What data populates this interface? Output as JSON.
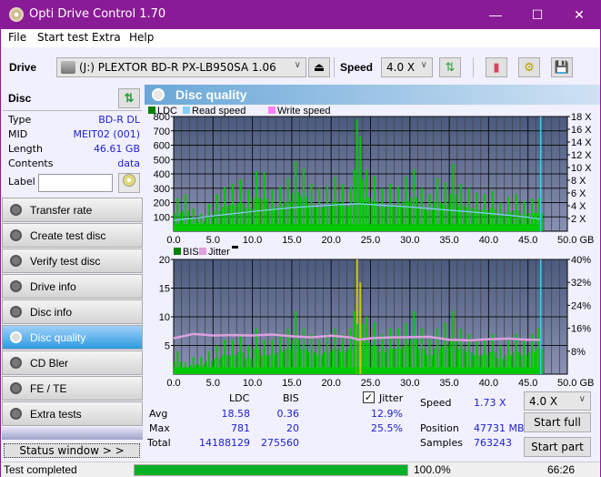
{
  "window": {
    "title": "Opti Drive Control 1.70",
    "minimize_icon": "minimize-icon",
    "maximize_icon": "maximize-icon",
    "close_icon": "close-icon"
  },
  "menu": [
    "File",
    "Start test",
    "Extra",
    "Help"
  ],
  "toolbar": {
    "drive_label": "Drive",
    "drive_value": "(J:)  PLEXTOR BD-R  PX-LB950SA 1.06",
    "speed_label": "Speed",
    "speed_value": "4.0 X"
  },
  "disc": {
    "header": "Disc",
    "fields": [
      {
        "key": "Type",
        "value": "BD-R DL"
      },
      {
        "key": "MID",
        "value": "MEIT02 (001)"
      },
      {
        "key": "Length",
        "value": "46.61 GB"
      },
      {
        "key": "Contents",
        "value": "data"
      }
    ],
    "label_key": "Label",
    "label_value": ""
  },
  "nav": [
    {
      "label": "Transfer rate",
      "active": false
    },
    {
      "label": "Create test disc",
      "active": false
    },
    {
      "label": "Verify test disc",
      "active": false
    },
    {
      "label": "Drive info",
      "active": false
    },
    {
      "label": "Disc info",
      "active": false
    },
    {
      "label": "Disc quality",
      "active": true
    },
    {
      "label": "CD Bler",
      "active": false
    },
    {
      "label": "FE / TE",
      "active": false
    },
    {
      "label": "Extra tests",
      "active": false
    }
  ],
  "status_window_label": "Status window > >",
  "main": {
    "title": "Disc quality"
  },
  "chart_data": [
    {
      "type": "bar",
      "title": "LDC",
      "legend": [
        "LDC",
        "Read speed",
        "Write speed"
      ],
      "legend_colors": {
        "LDC": "#008000",
        "Read speed": "#87cefa",
        "Write speed": "#ff80ff"
      },
      "xlabel": "GB",
      "x_ticks": [
        "0.0",
        "5.0",
        "10.0",
        "15.0",
        "20.0",
        "25.0",
        "30.0",
        "35.0",
        "40.0",
        "45.0",
        "50.0 GB"
      ],
      "xlim": [
        0,
        50
      ],
      "y_left_ticks": [
        "100",
        "200",
        "300",
        "400",
        "500",
        "600",
        "700",
        "800"
      ],
      "ylim_left": [
        0,
        800
      ],
      "y_right_ticks": [
        "2 X",
        "4 X",
        "6 X",
        "8 X",
        "10 X",
        "12 X",
        "14 X",
        "16 X",
        "18 X"
      ],
      "ylim_right": [
        0,
        18
      ],
      "series": [
        {
          "name": "LDC",
          "color": "#00c800",
          "x": [
            0.5,
            1.5,
            2.5,
            3.5,
            4.5,
            5.5,
            6.5,
            7.5,
            8.5,
            9.5,
            10.5,
            11.5,
            12.5,
            13.5,
            14.5,
            15.5,
            16.5,
            17.5,
            18.5,
            19.5,
            20.5,
            21.5,
            22.5,
            23.3,
            23.7,
            24.5,
            25.5,
            26.5,
            27.5,
            28.5,
            29.5,
            30.5,
            31.5,
            32.5,
            33.5,
            34.5,
            35.5,
            36.5,
            37.5,
            38.5,
            39.5,
            40.5,
            41.5,
            42.5,
            43.5,
            44.5,
            45.5,
            46.4
          ],
          "values": [
            230,
            260,
            160,
            120,
            190,
            260,
            310,
            330,
            360,
            290,
            420,
            410,
            290,
            310,
            370,
            490,
            440,
            330,
            300,
            320,
            380,
            330,
            310,
            781,
            660,
            430,
            380,
            300,
            330,
            310,
            380,
            430,
            300,
            260,
            370,
            340,
            470,
            330,
            300,
            270,
            260,
            280,
            200,
            240,
            260,
            210,
            230,
            230
          ]
        },
        {
          "name": "Read speed",
          "color": "#87cefa",
          "x": [
            0,
            5,
            10,
            15,
            20,
            23.5,
            25,
            30,
            35,
            40,
            45,
            46.6
          ],
          "values": [
            1.7,
            2.4,
            3.1,
            3.7,
            4.1,
            4.3,
            4.2,
            3.8,
            3.3,
            2.8,
            2.2,
            1.9
          ]
        }
      ],
      "end_marker_x": 46.61
    },
    {
      "type": "bar",
      "title": "BIS / Jitter",
      "legend": [
        "BIS",
        "Jitter"
      ],
      "legend_colors": {
        "BIS": "#008000",
        "Jitter": "#dda0dd"
      },
      "xlabel": "GB",
      "x_ticks": [
        "0.0",
        "5.0",
        "10.0",
        "15.0",
        "20.0",
        "25.0",
        "30.0",
        "35.0",
        "40.0",
        "45.0",
        "50.0 GB"
      ],
      "xlim": [
        0,
        50
      ],
      "y_left_ticks": [
        "5",
        "10",
        "15",
        "20"
      ],
      "ylim_left": [
        0,
        20
      ],
      "y_right_ticks": [
        "8%",
        "16%",
        "24%",
        "32%",
        "40%"
      ],
      "ylim_right": [
        0,
        40
      ],
      "series": [
        {
          "name": "BIS",
          "color": "#00c800",
          "x": [
            0.5,
            1.5,
            2.5,
            3.5,
            4.5,
            5.5,
            6.5,
            7.5,
            8.5,
            9.5,
            10.5,
            11.5,
            12.5,
            13.5,
            14.5,
            15.5,
            16.5,
            17.5,
            18.5,
            19.5,
            20.5,
            21.5,
            22.5,
            23.3,
            23.7,
            24.5,
            25.5,
            26.5,
            27.5,
            28.5,
            29.5,
            30.5,
            31.5,
            32.5,
            33.5,
            34.5,
            35.5,
            36.5,
            37.5,
            38.5,
            39.5,
            40.5,
            41.5,
            42.5,
            43.5,
            44.5,
            45.5,
            46.4
          ],
          "values": [
            4,
            2,
            3,
            3,
            4,
            5,
            6,
            6,
            7,
            5,
            8,
            6,
            6,
            7,
            8,
            11,
            8,
            7,
            6,
            7,
            8,
            7,
            8,
            20,
            16,
            10,
            9,
            7,
            8,
            8,
            9,
            11,
            8,
            6,
            8,
            9,
            11,
            8,
            7,
            6,
            6,
            7,
            5,
            6,
            7,
            6,
            7,
            8
          ]
        },
        {
          "name": "Jitter",
          "color": "#dda0dd",
          "x": [
            0,
            2.5,
            5,
            7.5,
            10,
            12.5,
            15,
            17.5,
            20,
            22.5,
            23.5,
            25,
            27.5,
            30,
            32.5,
            35,
            37.5,
            40,
            42.5,
            45,
            46.6
          ],
          "values": [
            12.5,
            14.0,
            13.5,
            13.6,
            13.5,
            13.8,
            13.2,
            12.8,
            13.4,
            12.8,
            12.0,
            12.5,
            12.8,
            12.9,
            13.0,
            12.0,
            11.8,
            12.2,
            12.4,
            12.0,
            12.0
          ]
        }
      ],
      "end_marker_x": 46.61
    }
  ],
  "stats": {
    "col_ldc": "LDC",
    "col_bis": "BIS",
    "jitter_label": "Jitter",
    "jitter_checked": true,
    "rows": [
      {
        "label": "Avg",
        "ldc": "18.58",
        "bis": "0.36",
        "jitter": "12.9%"
      },
      {
        "label": "Max",
        "ldc": "781",
        "bis": "20",
        "jitter": "25.5%"
      },
      {
        "label": "Total",
        "ldc": "14188129",
        "bis": "275560",
        "jitter": ""
      }
    ],
    "speed_label": "Speed",
    "speed_value": "1.73 X",
    "position_label": "Position",
    "position_value": "47731 MB",
    "samples_label": "Samples",
    "samples_value": "763243",
    "speed_select": "4.0 X",
    "start_full": "Start full",
    "start_part": "Start part"
  },
  "statusbar": {
    "text": "Test completed",
    "progress": 100.0,
    "progress_text": "100.0%",
    "time": "66:26"
  }
}
